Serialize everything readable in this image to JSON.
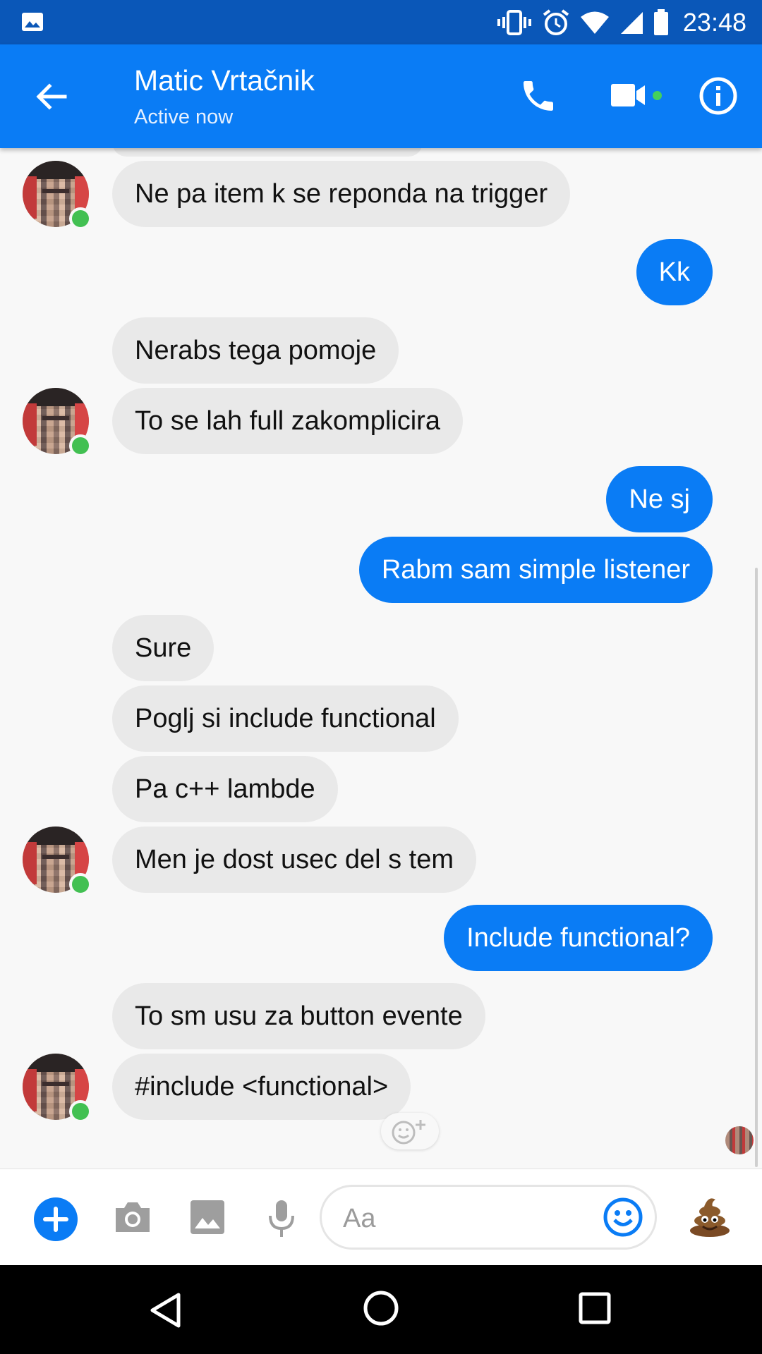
{
  "status_bar": {
    "time": "23:48"
  },
  "header": {
    "contact_name": "Matic Vrtačnik",
    "status": "Active now"
  },
  "messages": [
    {
      "from": "them",
      "text": "Ne pa item k se reponda na trigger"
    },
    {
      "from": "me",
      "text": "Kk"
    },
    {
      "from": "them",
      "text": "Nerabs tega pomoje"
    },
    {
      "from": "them",
      "text": "To se lah full zakomplicira"
    },
    {
      "from": "me",
      "text": "Ne sj"
    },
    {
      "from": "me",
      "text": "Rabm sam simple listener"
    },
    {
      "from": "them",
      "text": "Sure"
    },
    {
      "from": "them",
      "text": "Poglj si include functional"
    },
    {
      "from": "them",
      "text": "Pa c++ lambde"
    },
    {
      "from": "them",
      "text": "Men je dost usec del s tem"
    },
    {
      "from": "me",
      "text": "Include functional?"
    },
    {
      "from": "them",
      "text": "To sm usu za button evente"
    },
    {
      "from": "them",
      "text": "#include <functional>"
    }
  ],
  "composer": {
    "placeholder": "Aa"
  },
  "colors": {
    "accent": "#0a7cf5",
    "status_bar": "#0a57b8",
    "incoming_bubble": "#e9e9e9",
    "online": "#42c052"
  },
  "icons": [
    "gallery-icon",
    "vibrate-icon",
    "alarm-icon",
    "wifi-icon",
    "signal-icon",
    "battery-icon",
    "back-arrow-icon",
    "phone-icon",
    "video-camera-icon",
    "info-icon",
    "add-reaction-icon",
    "plus-icon",
    "camera-icon",
    "image-icon",
    "microphone-icon",
    "emoji-icon",
    "poop-emoji-icon",
    "nav-back-icon",
    "nav-home-icon",
    "nav-recents-icon"
  ]
}
